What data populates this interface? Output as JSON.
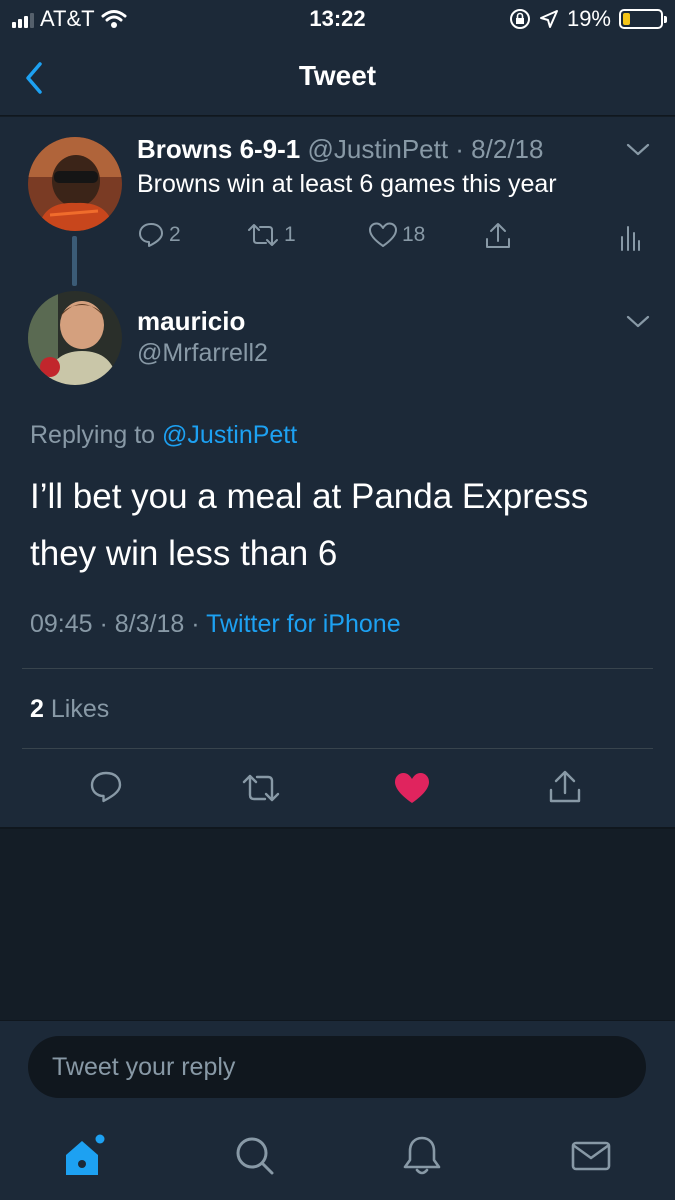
{
  "status_bar": {
    "carrier": "AT&T",
    "time": "13:22",
    "battery": "19%",
    "battery_level": 0.19
  },
  "nav": {
    "title": "Tweet"
  },
  "parent_tweet": {
    "name": "Browns 6-9-1",
    "handle": "@JustinPett",
    "date": "8/2/18",
    "text": "Browns win at least 6 games this year",
    "replies": "2",
    "retweets": "1",
    "likes": "18"
  },
  "reply_tweet": {
    "name": "mauricio",
    "handle": "@Mrfarrell2",
    "replying_prefix": "Replying to",
    "replying_to": "@JustinPett",
    "text": "I’ll bet you a meal at Panda Express they win less than 6",
    "time": "09:45",
    "date": "8/3/18",
    "source": "Twitter for iPhone",
    "likes_count": "2",
    "likes_label": "Likes",
    "liked": true
  },
  "composer": {
    "placeholder": "Tweet your reply"
  },
  "tab_bar": {
    "items": [
      "home-icon",
      "search-icon",
      "notifications-icon",
      "messages-icon"
    ],
    "active": "home-icon"
  },
  "colors": {
    "background": "#141d26",
    "panel": "#1c2938",
    "accent": "#1da1f2",
    "muted": "#8899a6",
    "like": "#e0245e"
  }
}
